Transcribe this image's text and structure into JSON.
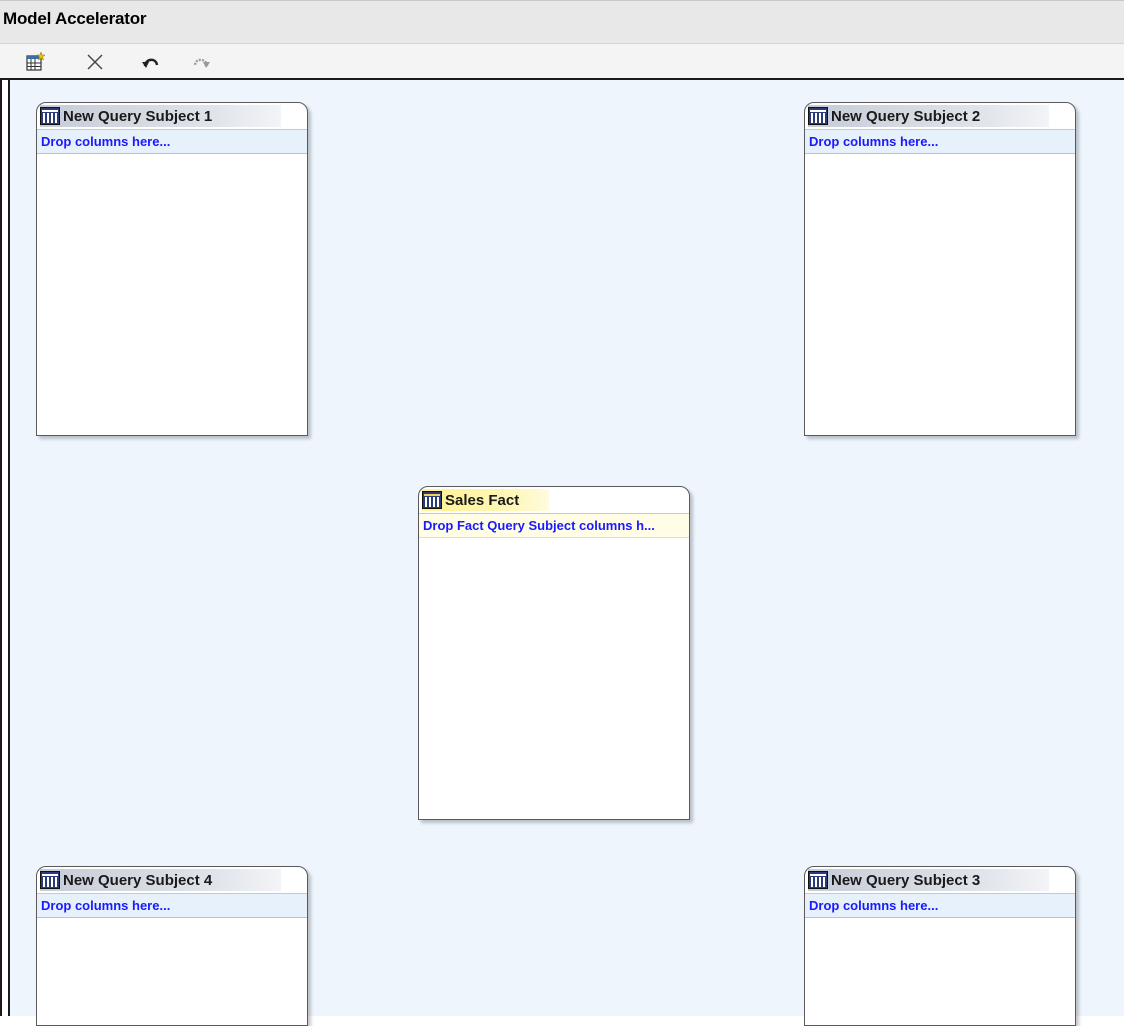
{
  "window": {
    "title": "Model Accelerator"
  },
  "toolbar": {
    "buttons": [
      {
        "name": "new-query-subject-button",
        "icon": "new-query-subject-icon"
      },
      {
        "name": "delete-button",
        "icon": "delete-x-icon"
      },
      {
        "name": "undo-button",
        "icon": "undo-icon"
      },
      {
        "name": "redo-button",
        "icon": "redo-icon"
      }
    ]
  },
  "query_subjects": [
    {
      "title": "New Query Subject 1",
      "drop_text": "Drop columns here..."
    },
    {
      "title": "New Query Subject 2",
      "drop_text": "Drop columns here..."
    },
    {
      "title": "New Query Subject 3",
      "drop_text": "Drop columns here..."
    },
    {
      "title": "New Query Subject 4",
      "drop_text": "Drop columns here..."
    }
  ],
  "fact": {
    "title": "Sales Fact",
    "drop_text": "Drop Fact Query Subject columns h..."
  },
  "colors": {
    "canvas_bg": "#eef5fd",
    "drop_text": "#1a1aff",
    "fact_header": "#fff28f",
    "dim_header": "#c6ccd6"
  }
}
